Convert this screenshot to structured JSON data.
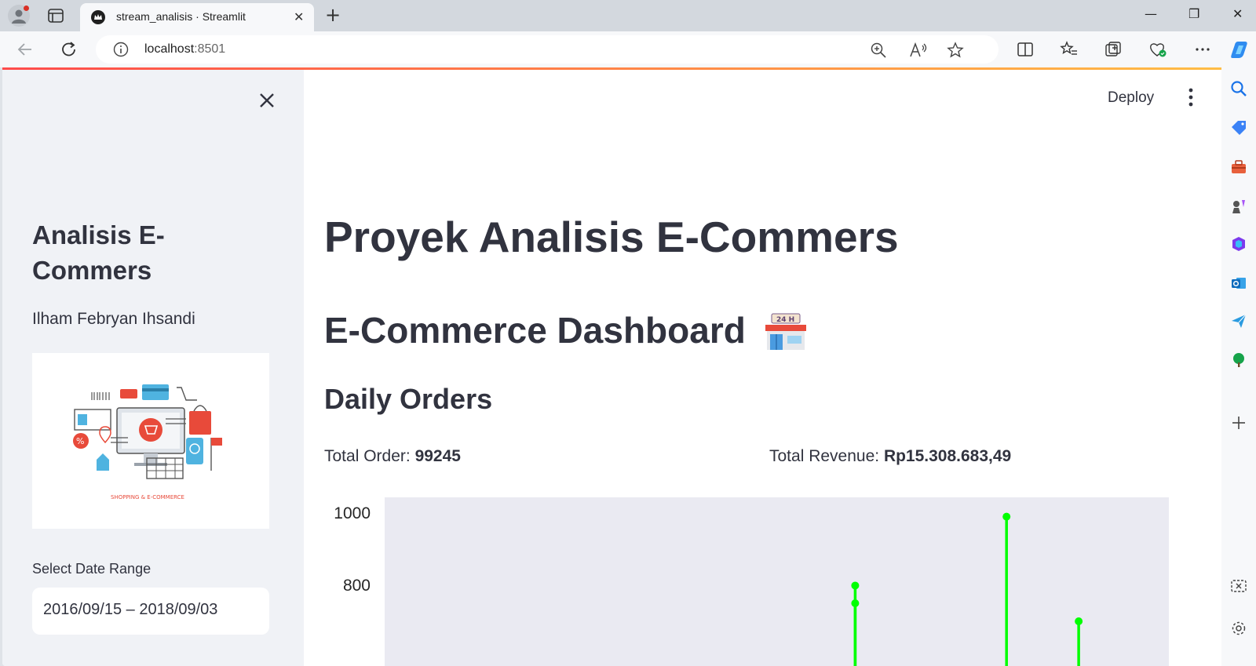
{
  "browser": {
    "tab_title": "stream_analisis · Streamlit",
    "url_host": "localhost",
    "url_port": ":8501",
    "tab_close": "✕",
    "new_tab": "+",
    "min": "—",
    "max": "❐",
    "close": "✕"
  },
  "sidebar": {
    "title": "Analisis E-Commers",
    "author": "Ilham Febryan Ihsandi",
    "image_caption": "SHOPPING & E-COMMERCE",
    "date_label": "Select Date Range",
    "date_value": "2016/09/15 – 2018/09/03"
  },
  "header": {
    "deploy_label": "Deploy"
  },
  "main": {
    "title": "Proyek Analisis E-Commers",
    "dashboard_title": "E-Commerce Dashboard",
    "dashboard_emoji_text": "24 H",
    "section_title": "Daily Orders",
    "total_order_label": "Total Order:",
    "total_order_value": "99245",
    "total_revenue_label": "Total Revenue:",
    "total_revenue_value": "Rp15.308.683,49"
  },
  "chart_data": {
    "type": "line",
    "title": "",
    "xlabel": "",
    "ylabel": "",
    "y_ticks_visible": [
      1000,
      800
    ],
    "ylim_visible": [
      760,
      1050
    ],
    "x_fraction_range": [
      0,
      1
    ],
    "series": [
      {
        "color": "#00ff00",
        "points": [
          {
            "x": 0.6,
            "y": 799
          },
          {
            "x": 0.6,
            "y": 750
          },
          {
            "x": 0.793,
            "y": 990
          },
          {
            "x": 0.885,
            "y": 700
          }
        ]
      }
    ],
    "plot_bg": "#eaeaf2",
    "grid": false
  }
}
